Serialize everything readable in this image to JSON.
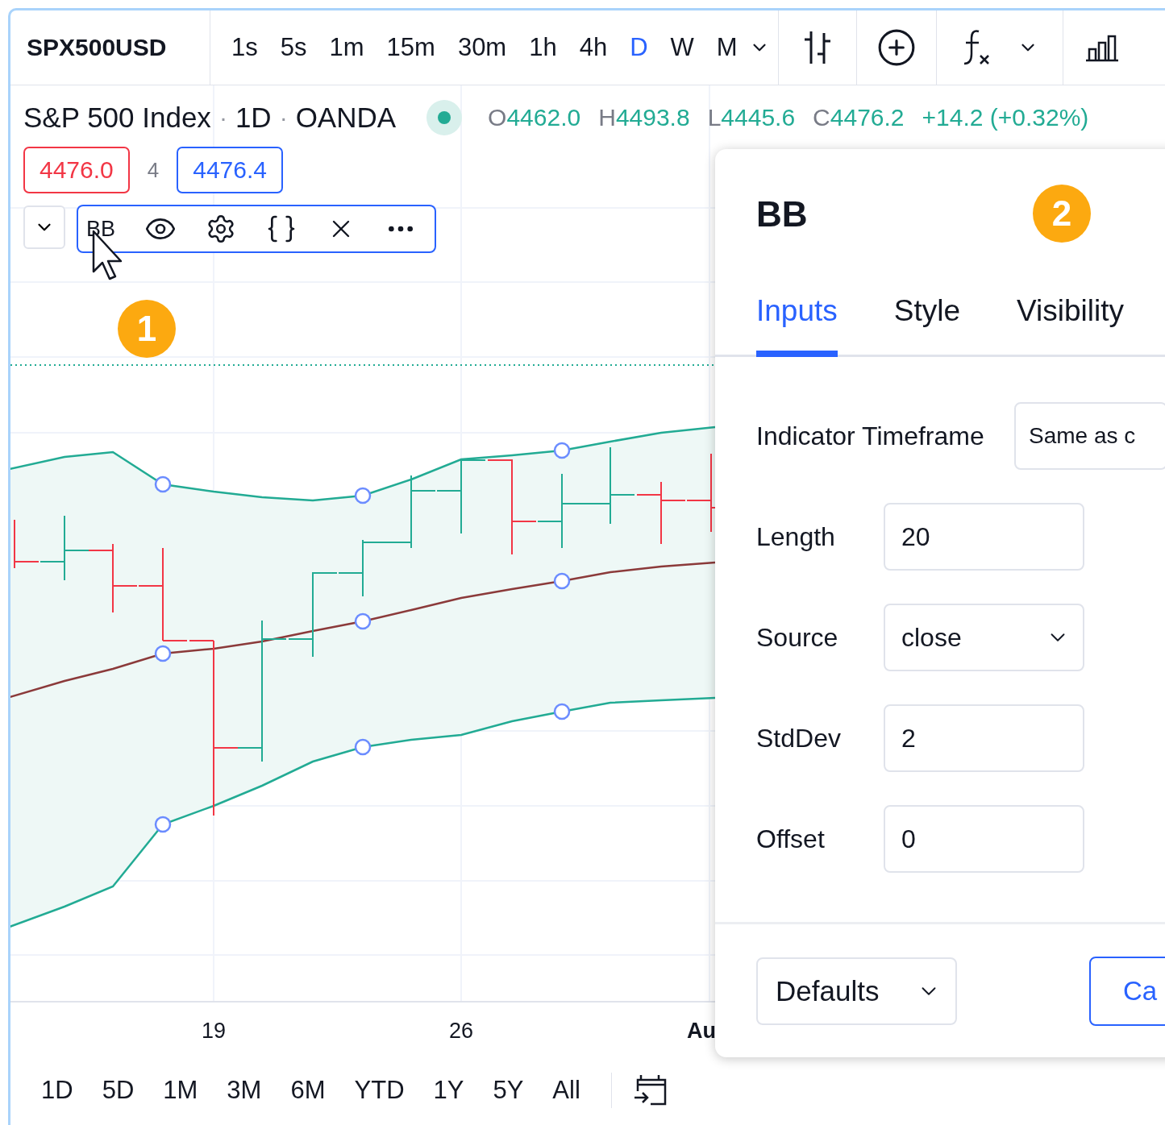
{
  "toolbar": {
    "symbol": "SPX500USD",
    "intervals": [
      {
        "label": "1s",
        "selected": false
      },
      {
        "label": "5s",
        "selected": false
      },
      {
        "label": "1m",
        "selected": false
      },
      {
        "label": "15m",
        "selected": false
      },
      {
        "label": "30m",
        "selected": false
      },
      {
        "label": "1h",
        "selected": false
      },
      {
        "label": "4h",
        "selected": false
      },
      {
        "label": "D",
        "selected": true
      },
      {
        "label": "W",
        "selected": false
      },
      {
        "label": "M",
        "selected": false
      }
    ]
  },
  "legend": {
    "parts": [
      "S&P 500 Index",
      "·",
      "1D",
      "·",
      "OANDA"
    ],
    "ohlc": [
      {
        "letter": "O",
        "value": "4462.0"
      },
      {
        "letter": "H",
        "value": "4493.8"
      },
      {
        "letter": "L",
        "value": "4445.6"
      },
      {
        "letter": "C",
        "value": "4476.2"
      }
    ],
    "change": "+14.2 (+0.32%)"
  },
  "price_tags": {
    "bid": "4476.0",
    "spread": "4",
    "ask": "4476.4"
  },
  "indicator": {
    "name": "BB"
  },
  "callouts": [
    "1",
    "2"
  ],
  "x_axis": [
    "19",
    "26",
    "Au"
  ],
  "ranges": [
    "1D",
    "5D",
    "1M",
    "3M",
    "6M",
    "YTD",
    "1Y",
    "5Y",
    "All"
  ],
  "dialog": {
    "title": "BB",
    "tabs": [
      {
        "label": "Inputs",
        "selected": true
      },
      {
        "label": "Style",
        "selected": false
      },
      {
        "label": "Visibility",
        "selected": false
      }
    ],
    "fields": [
      {
        "label": "Indicator Timeframe",
        "kind": "wide",
        "value": "Same as c"
      },
      {
        "label": "Length",
        "kind": "input",
        "value": "20"
      },
      {
        "label": "Source",
        "kind": "select",
        "value": "close"
      },
      {
        "label": "StdDev",
        "kind": "input",
        "value": "2"
      },
      {
        "label": "Offset",
        "kind": "input",
        "value": "0"
      }
    ],
    "defaults_button": "Defaults",
    "cancel_button": "Ca"
  }
}
